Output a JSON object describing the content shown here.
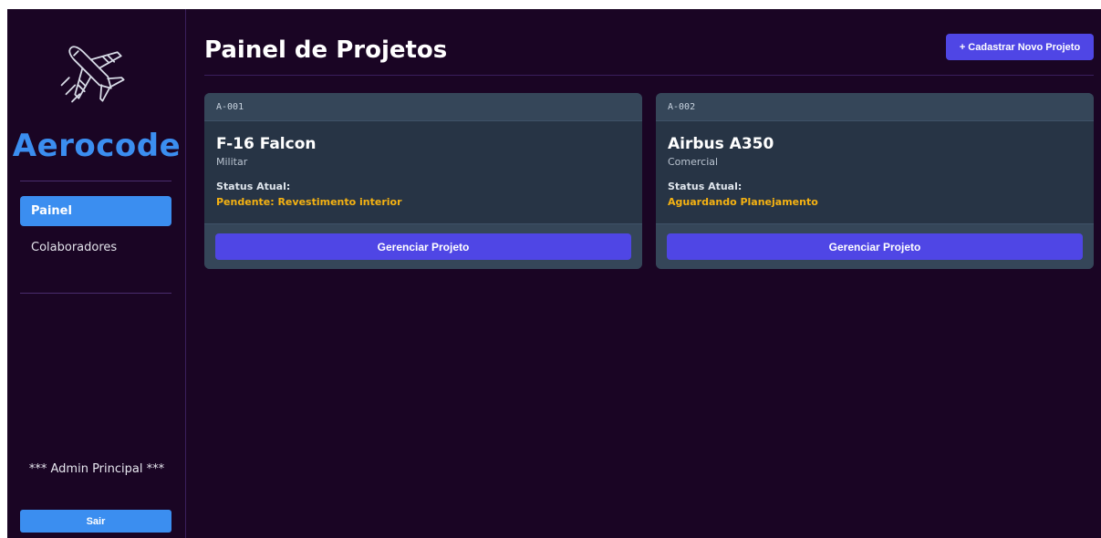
{
  "sidebar": {
    "logo_icon": "airplane-icon",
    "brand": "Aerocode",
    "nav": [
      {
        "label": "Painel",
        "active": true
      },
      {
        "label": "Colaboradores",
        "active": false
      }
    ],
    "admin_label": "*** Admin Principal ***",
    "logout_label": "Sair"
  },
  "header": {
    "title": "Painel de Projetos",
    "new_project_label": "+ Cadastrar Novo Projeto"
  },
  "projects": [
    {
      "code": "A-001",
      "name": "F-16 Falcon",
      "category": "Militar",
      "status_label": "Status Atual:",
      "status_value": "Pendente: Revestimento interior",
      "action_label": "Gerenciar Projeto"
    },
    {
      "code": "A-002",
      "name": "Airbus A350",
      "category": "Comercial",
      "status_label": "Status Atual:",
      "status_value": "Aguardando Planejamento",
      "action_label": "Gerenciar Projeto"
    }
  ],
  "colors": {
    "background": "#1a0524",
    "accent_blue": "#3b8ef0",
    "button_indigo": "#4f46e5",
    "card": "#273445",
    "status_amber": "#f5b212"
  }
}
